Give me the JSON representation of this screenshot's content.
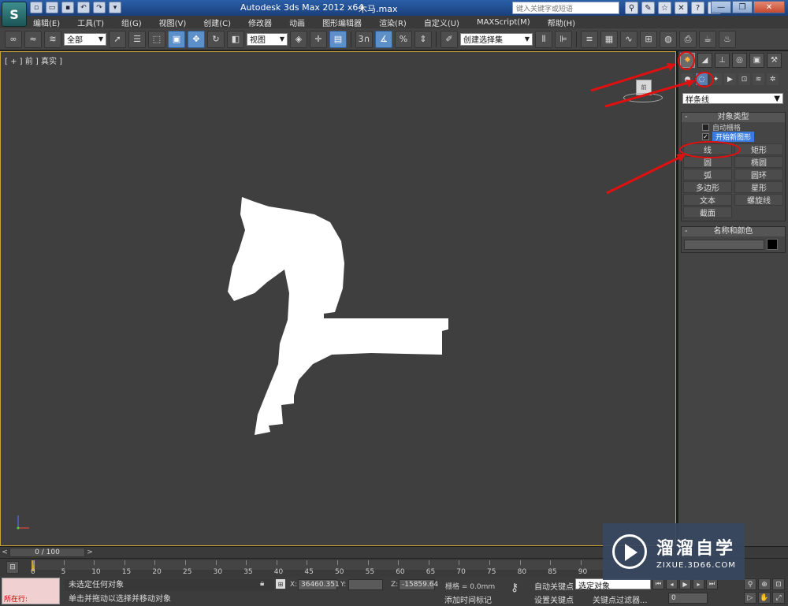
{
  "titlebar": {
    "app_name": "Autodesk 3ds Max  2012 x64",
    "file_name": "木马.max",
    "search_placeholder": "键入关键字或短语",
    "logo_glyph": "S"
  },
  "menu": [
    "编辑(E)",
    "工具(T)",
    "组(G)",
    "视图(V)",
    "创建(C)",
    "修改器",
    "动画",
    "图形编辑器",
    "渲染(R)",
    "自定义(U)",
    "MAXScript(M)",
    "帮助(H)"
  ],
  "toolbar": {
    "selection_filter": "全部",
    "reference_coord": "视图",
    "snap_label": "3",
    "named_selection": "创建选择集"
  },
  "viewport": {
    "label": "[ + ] 前 ] 真实 ]",
    "viewcube_label": "前"
  },
  "command_panel": {
    "category": "样条线",
    "object_type": {
      "title": "对象类型",
      "autogrid": "自动栅格",
      "start_new_shape": "开始新图形",
      "buttons": [
        "线",
        "矩形",
        "圆",
        "椭圆",
        "弧",
        "圆环",
        "多边形",
        "星形",
        "文本",
        "螺旋线",
        "截面"
      ]
    },
    "name_color": {
      "title": "名称和颜色",
      "color": "#000000"
    }
  },
  "timeline": {
    "frame_display": "0 / 100",
    "ticks": [
      "0",
      "5",
      "10",
      "15",
      "20",
      "25",
      "30",
      "35",
      "40",
      "45",
      "50",
      "55",
      "60",
      "65",
      "70",
      "75",
      "80",
      "85",
      "90"
    ]
  },
  "status": {
    "running": "所在行:",
    "selection_status": "未选定任何对象",
    "prompt": "单击并拖动以选择并移动对象",
    "x_label": "X:",
    "x_value": "36460.351",
    "y_label": "Y:",
    "y_value": "",
    "z_label": "Z:",
    "z_value": "-15859.64",
    "grid": "栅格 = 0.0mm",
    "add_time_tag": "添加时间标记",
    "auto_key": "自动关键点",
    "set_key": "设置关键点",
    "selected_dropdown": "选定对象",
    "key_filters": "关键点过滤器...",
    "current_frame": "0"
  },
  "watermark": {
    "cn": "溜溜自学",
    "en": "ZIXUE.3D66.COM"
  },
  "colors": {
    "annotation": "#e01010",
    "viewport_bg": "#3f3f3f",
    "viewport_border": "#c9a33a",
    "highlight": "#3b7be0"
  }
}
